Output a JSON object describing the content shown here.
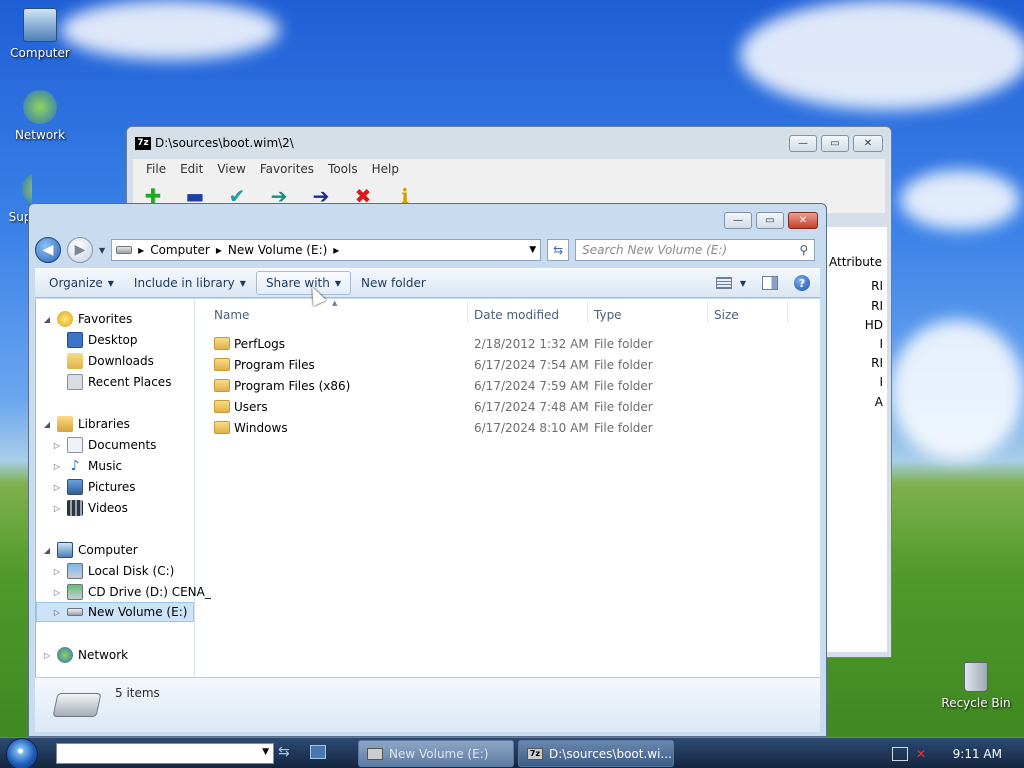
{
  "desktop": {
    "icons": [
      {
        "label": "Computer",
        "icon": "computer-icon"
      },
      {
        "label": "Network",
        "icon": "network-icon"
      },
      {
        "label": "Sup",
        "icon": "support-icon"
      },
      {
        "label": "Recycle Bin",
        "icon": "recycle-bin-icon"
      }
    ]
  },
  "sevenzip": {
    "title": "D:\\sources\\boot.wim\\2\\",
    "logo": "7z",
    "menu": [
      "File",
      "Edit",
      "View",
      "Favorites",
      "Tools",
      "Help"
    ],
    "toolbar_icons": [
      "add-icon",
      "extract-icon",
      "test-icon",
      "copy-icon",
      "move-icon",
      "delete-icon",
      "info-icon"
    ],
    "column_header": "Attribute",
    "attribute_values": [
      "RI",
      "RI",
      "HD",
      "I",
      "RI",
      "I",
      "A"
    ]
  },
  "explorer": {
    "breadcrumb": [
      "Computer",
      "New Volume (E:)"
    ],
    "search_placeholder": "Search New Volume (E:)",
    "commands": {
      "organize": "Organize",
      "include_in_library": "Include in library",
      "share_with": "Share with",
      "new_folder": "New folder"
    },
    "nav": {
      "favorites": "Favorites",
      "desktop": "Desktop",
      "downloads": "Downloads",
      "recent_places": "Recent Places",
      "libraries": "Libraries",
      "documents": "Documents",
      "music": "Music",
      "pictures": "Pictures",
      "videos": "Videos",
      "computer": "Computer",
      "local_disk": "Local Disk (C:)",
      "cd_drive": "CD Drive (D:) CENA_",
      "new_volume": "New Volume (E:)",
      "network": "Network"
    },
    "columns": {
      "name": "Name",
      "date": "Date modified",
      "type": "Type",
      "size": "Size"
    },
    "files": [
      {
        "name": "PerfLogs",
        "date": "2/18/2012 1:32 AM",
        "type": "File folder"
      },
      {
        "name": "Program Files",
        "date": "6/17/2024 7:54 AM",
        "type": "File folder"
      },
      {
        "name": "Program Files (x86)",
        "date": "6/17/2024 7:59 AM",
        "type": "File folder"
      },
      {
        "name": "Users",
        "date": "6/17/2024 7:48 AM",
        "type": "File folder"
      },
      {
        "name": "Windows",
        "date": "6/17/2024 8:10 AM",
        "type": "File folder"
      }
    ],
    "status": "5 items"
  },
  "taskbar": {
    "tasks": [
      {
        "label": "New Volume (E:)",
        "active": true
      },
      {
        "label": "D:\\sources\\boot.wi...",
        "active": false
      }
    ],
    "clock": "9:11 AM"
  }
}
